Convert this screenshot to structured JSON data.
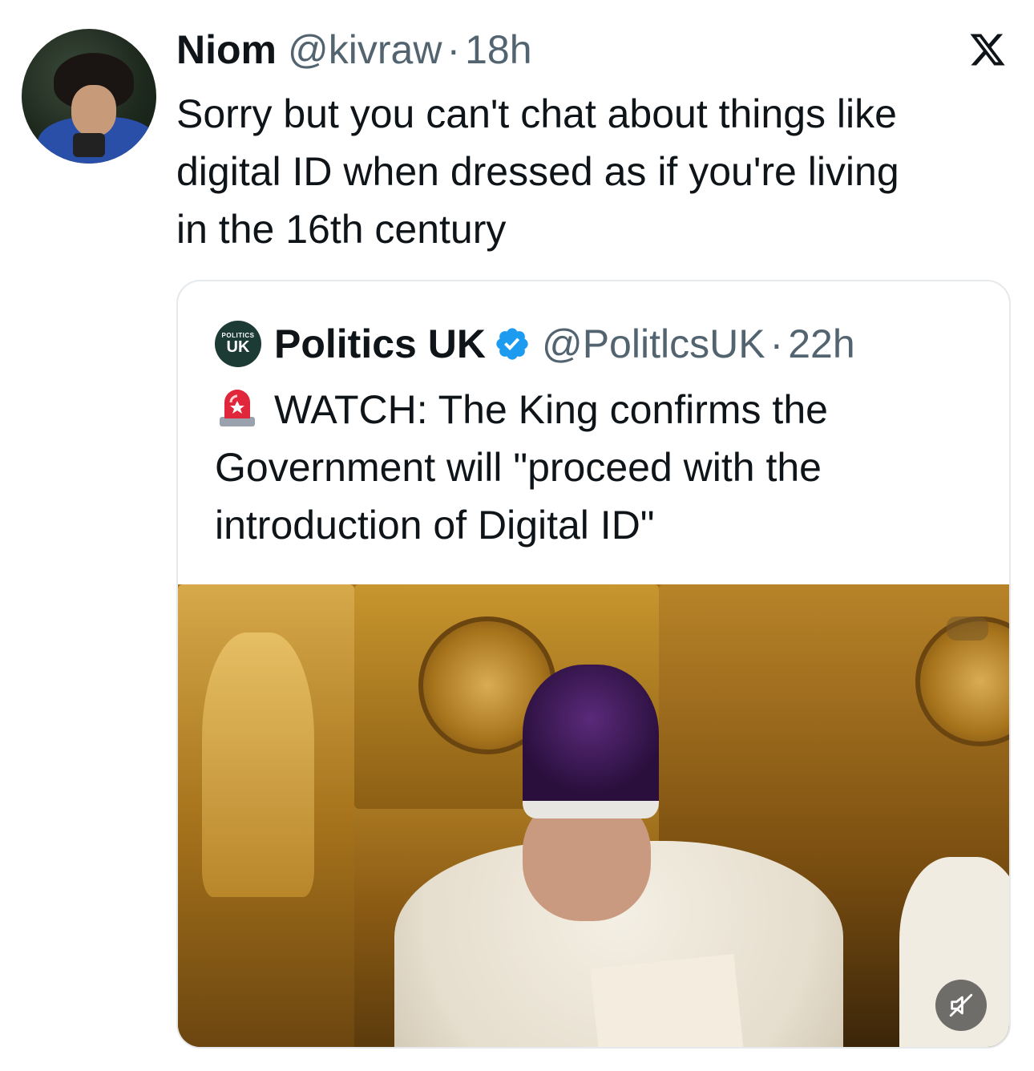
{
  "post": {
    "author_name": "Niom",
    "author_handle": "@kivraw",
    "separator": "·",
    "time": "18h",
    "text": "Sorry but you can't chat about things like\ndigital ID when dressed as if you're living\nin the 16th century",
    "platform_icon": "x-logo-icon"
  },
  "quoted": {
    "avatar_text_top": "POLITICS",
    "avatar_text_main": "UK",
    "author_name": "Politics UK",
    "verified_icon": "verified-badge-icon",
    "author_handle": "@PolitlcsUK",
    "separator": "·",
    "time": "22h",
    "emoji": "🚨",
    "text": "WATCH: The King confirms the Government will \"proceed with the introduction of Digital ID\"",
    "media": {
      "type": "video",
      "muted_icon": "speaker-muted-icon"
    }
  },
  "colors": {
    "text": "#0f1419",
    "secondary": "#536471",
    "verified": "#1d9bf0",
    "border": "#e6e9ec"
  }
}
